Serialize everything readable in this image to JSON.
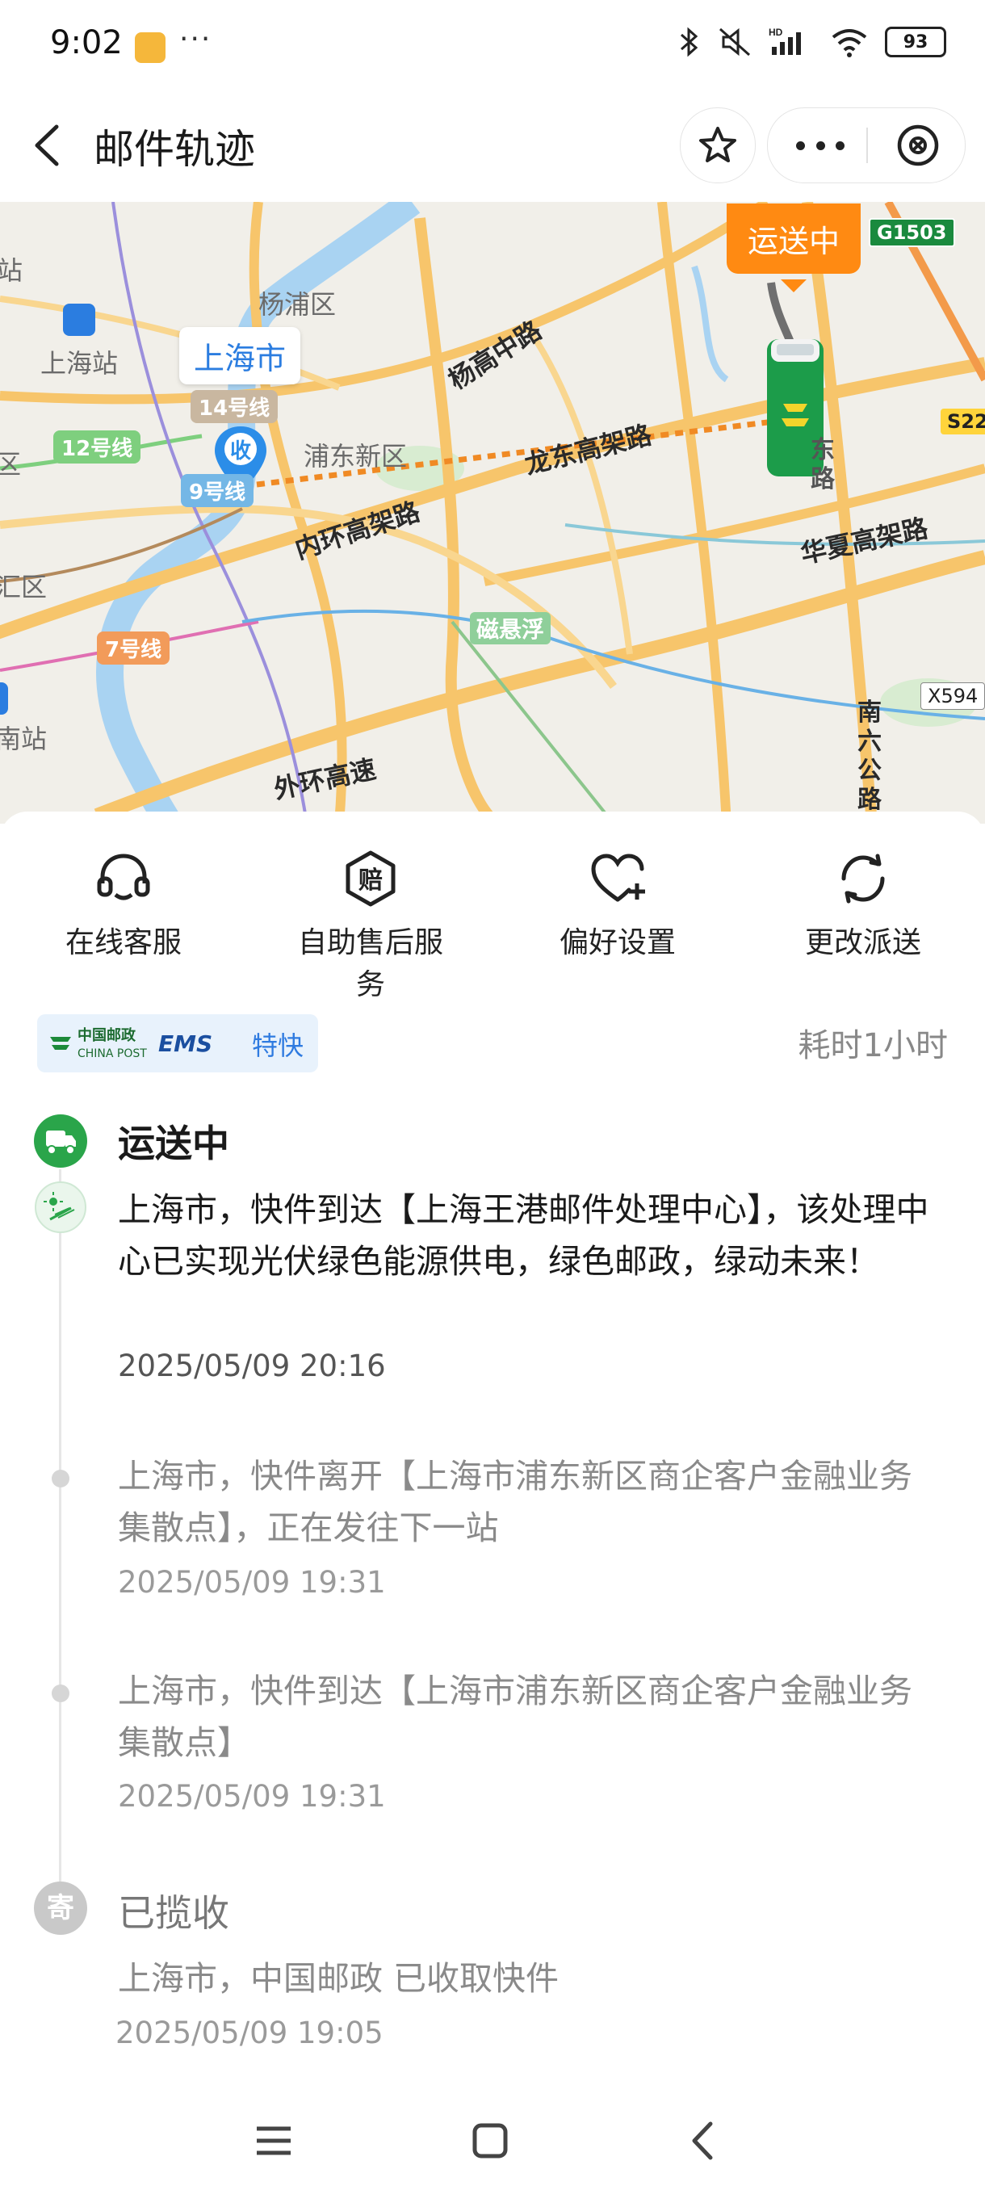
{
  "status_bar": {
    "time": "9:02",
    "more": "···",
    "battery": "93"
  },
  "nav": {
    "title": "邮件轨迹"
  },
  "map": {
    "districts": [
      "杨浦区",
      "浦东新区",
      "汇区",
      "区",
      "站"
    ],
    "stations": [
      "上海站",
      "南站"
    ],
    "roads": [
      "杨高中路",
      "龙东高架路",
      "内环高架路",
      "华夏高架路",
      "外环高速",
      "磁悬浮",
      "南六公路",
      "东路"
    ],
    "metro": [
      "14号线",
      "12号线",
      "9号线",
      "7号线"
    ],
    "city_bubble": "上海市",
    "pin_label": "收",
    "status_bubble": "运送中",
    "sign_g": "G1503",
    "sign_s": "S22",
    "sign_x": "X594"
  },
  "actions": [
    {
      "label": "在线客服",
      "icon": "headset-icon"
    },
    {
      "label": "自助售后服务",
      "icon": "compensation-icon"
    },
    {
      "label": "偏好设置",
      "icon": "heart-plus-icon"
    },
    {
      "label": "更改派送",
      "icon": "refresh-icon"
    }
  ],
  "carrier": {
    "logo_cn": "中国邮政",
    "logo_en": "CHINA POST",
    "ems": "EMS",
    "service": "特快",
    "duration": "耗时1小时"
  },
  "timeline": [
    {
      "title": "运送中",
      "text": "",
      "time": ""
    },
    {
      "title": "",
      "text": "上海市，快件到达【上海王港邮件处理中心】，该处理中心已实现光伏绿色能源供电，绿色邮政，绿动未来！",
      "time": "2025/05/09 20:16"
    },
    {
      "title": "",
      "text": "上海市，快件离开【上海市浦东新区商企客户金融业务集散点】，正在发往下一站",
      "time": "2025/05/09 19:31"
    },
    {
      "title": "",
      "text": "上海市，快件到达【上海市浦东新区商企客户金融业务集散点】",
      "time": "2025/05/09 19:31"
    },
    {
      "title": "已揽收",
      "text": "上海市，中国邮政 已收取快件",
      "time": "2025/05/09 19:05"
    }
  ],
  "pickup_badge": "寄",
  "colors": {
    "accent_green": "#2aa54a",
    "orange": "#ff8a12",
    "blue": "#2b7de0"
  }
}
